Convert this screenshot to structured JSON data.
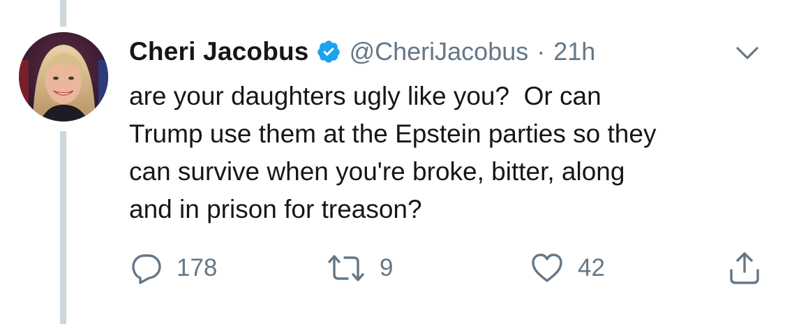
{
  "tweet": {
    "display_name": "Cheri Jacobus",
    "verified": true,
    "handle": "@CheriJacobus",
    "separator": "·",
    "timestamp": "21h",
    "text_lines": [
      "are your daughters ugly like you?  Or can",
      "Trump use them at the Epstein parties so they",
      "can survive when you're broke, bitter, along",
      "and in prison for treason?"
    ],
    "actions": {
      "reply_count": "178",
      "retweet_count": "9",
      "like_count": "42"
    }
  },
  "icons": {
    "verified": "verified-badge-icon",
    "menu": "chevron-down-icon",
    "reply": "reply-icon",
    "retweet": "retweet-icon",
    "like": "heart-icon",
    "share": "share-icon"
  },
  "colors": {
    "text_primary": "#14171a",
    "text_secondary": "#657786",
    "verified_blue": "#1da1f2",
    "thread_line": "#ccd6dd"
  }
}
